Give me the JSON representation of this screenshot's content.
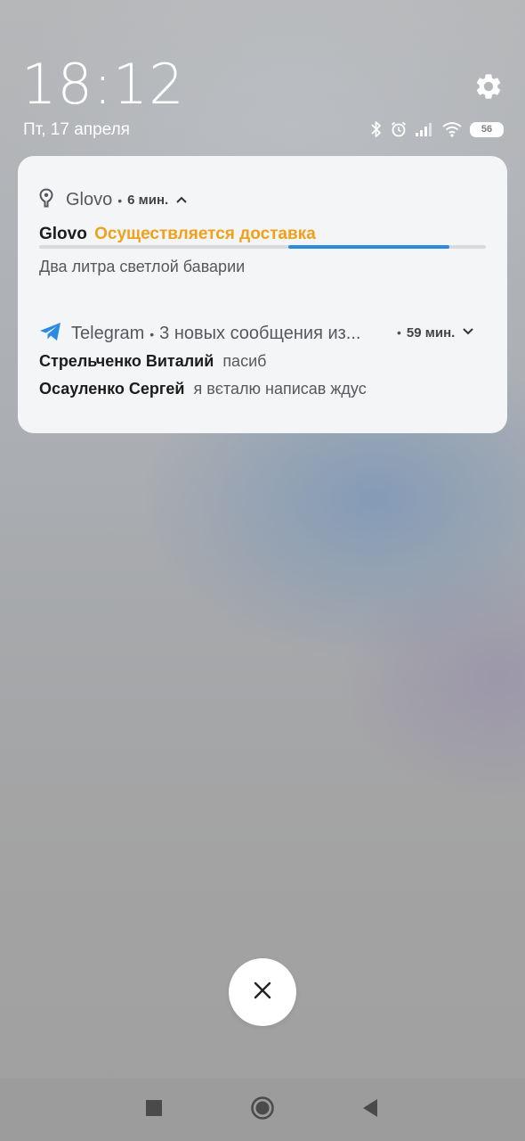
{
  "status": {
    "time": "18:12",
    "date": "Пт, 17 апреля",
    "battery": "56"
  },
  "notifications": {
    "glovo": {
      "app_name": "Glovo",
      "separator": "•",
      "time": "6 мин.",
      "title": "Glovo",
      "status": "Осуществляется доставка",
      "status_color": "#f0a01a",
      "progress_fraction": 0.36,
      "body": "Два литра светлой баварии"
    },
    "telegram": {
      "app_name": "Telegram",
      "separator": "•",
      "summary": "3 новых сообщения из...",
      "time_separator": "•",
      "time": "59 мин.",
      "accent_color": "#2b8be0",
      "messages": [
        {
          "sender": "Стрельченко Виталий",
          "text": "пасиб"
        },
        {
          "sender": "Осауленко Сергей",
          "text": "я вєталю написав ждус"
        }
      ]
    }
  },
  "icons": {
    "settings": "gear-icon",
    "bluetooth": "bluetooth-icon",
    "alarm": "alarm-icon",
    "signal": "signal-icon",
    "wifi": "wifi-icon",
    "glovo": "location-pin-icon",
    "telegram": "telegram-icon",
    "close": "close-icon"
  }
}
